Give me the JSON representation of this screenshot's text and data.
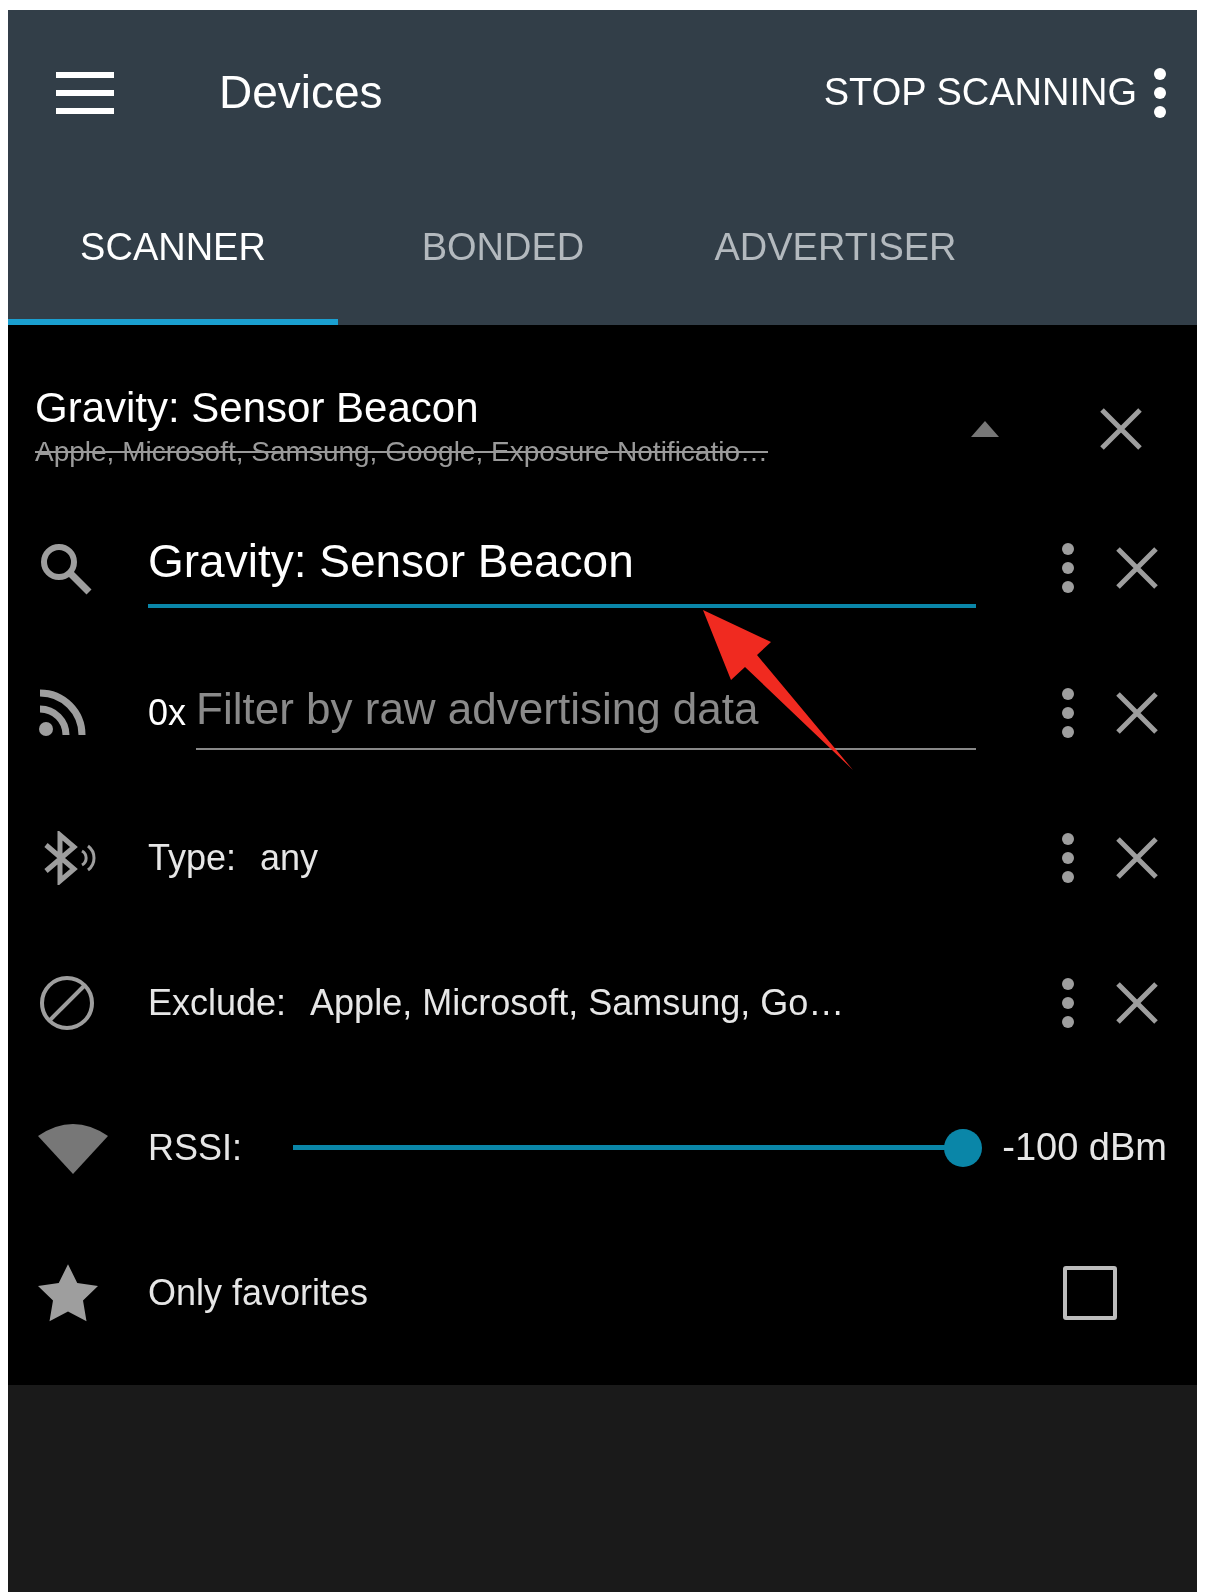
{
  "header": {
    "title": "Devices",
    "action": "STOP SCANNING"
  },
  "tabs": [
    {
      "label": "SCANNER",
      "selected": true
    },
    {
      "label": "BONDED",
      "selected": false
    },
    {
      "label": "ADVERTISER",
      "selected": false
    }
  ],
  "filter_summary": {
    "title": "Gravity: Sensor Beacon",
    "excluded": "Apple, Microsoft, Samsung, Google, Exposure Notificatio…",
    "expanded": true
  },
  "filters": [
    {
      "kind": "name",
      "value": "Gravity: Sensor Beacon"
    },
    {
      "kind": "raw",
      "prefix": "0x",
      "placeholder": "Filter by raw advertising data"
    },
    {
      "kind": "type",
      "label": "Type:",
      "value": "any"
    },
    {
      "kind": "exclude",
      "label": "Exclude:",
      "value": "Apple, Microsoft, Samsung, Go…"
    },
    {
      "kind": "rssi",
      "label": "RSSI:",
      "level": 1,
      "reading": "-100 dBm"
    },
    {
      "kind": "favorites",
      "label": "Only favorites",
      "checked": false
    }
  ]
}
